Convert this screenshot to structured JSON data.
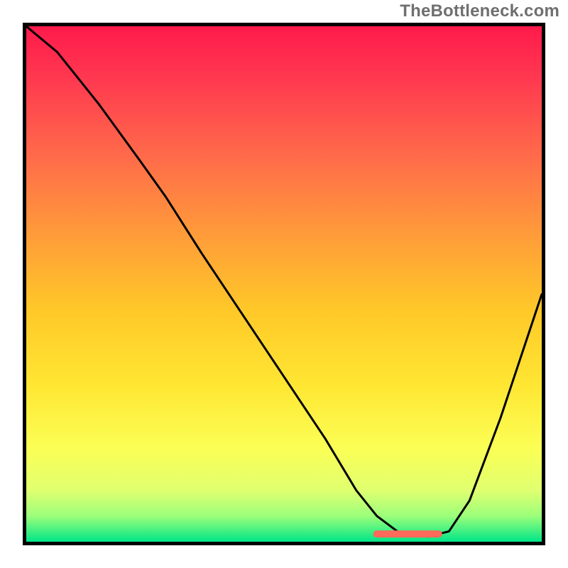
{
  "watermark": "TheBottleneck.com",
  "chart_data": {
    "type": "line",
    "title": "",
    "xlabel": "",
    "ylabel": "",
    "xlim": [
      0,
      100
    ],
    "ylim": [
      0,
      100
    ],
    "grid": false,
    "legend": false,
    "background_gradient": {
      "type": "vertical",
      "stops": [
        {
          "offset": 0,
          "color": "#ff1a4b"
        },
        {
          "offset": 0.1,
          "color": "#ff3850"
        },
        {
          "offset": 0.25,
          "color": "#ff6a4a"
        },
        {
          "offset": 0.4,
          "color": "#ff9a3a"
        },
        {
          "offset": 0.55,
          "color": "#ffc828"
        },
        {
          "offset": 0.7,
          "color": "#ffe733"
        },
        {
          "offset": 0.82,
          "color": "#fbff55"
        },
        {
          "offset": 0.9,
          "color": "#e0ff70"
        },
        {
          "offset": 0.95,
          "color": "#9cff7a"
        },
        {
          "offset": 1.0,
          "color": "#00e588"
        }
      ]
    },
    "series": [
      {
        "name": "curve",
        "color": "#000000",
        "x": [
          0,
          6,
          14,
          22,
          27,
          34,
          42,
          50,
          58,
          64,
          68,
          72,
          78,
          82,
          86,
          92,
          96,
          100
        ],
        "y": [
          100,
          95,
          85,
          74,
          67,
          56,
          44,
          32,
          20,
          10,
          5,
          2,
          1,
          2,
          8,
          24,
          36,
          48
        ]
      }
    ],
    "annotations": [
      {
        "name": "min-marker",
        "type": "segment",
        "color": "#ff6a5a",
        "x": [
          68,
          80
        ],
        "y": [
          1.5,
          1.5
        ],
        "thickness_px": 10
      }
    ],
    "axes": {
      "show_ticks": false,
      "border_color": "#000000",
      "border_width_px": 5
    }
  }
}
